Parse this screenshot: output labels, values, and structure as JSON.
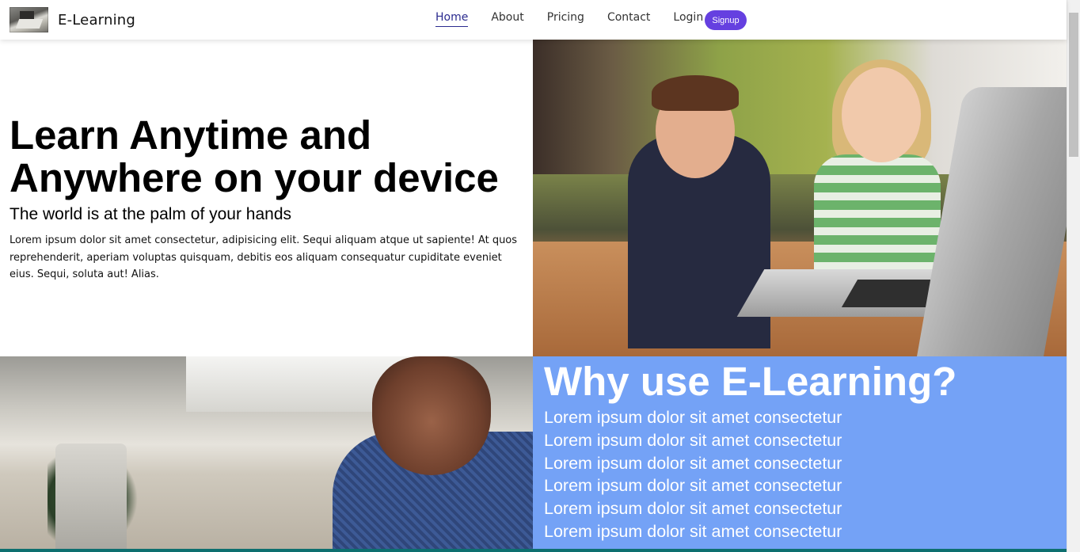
{
  "navbar": {
    "brand": "E-Learning",
    "links": [
      {
        "label": "Home",
        "active": true
      },
      {
        "label": "About",
        "active": false
      },
      {
        "label": "Pricing",
        "active": false
      },
      {
        "label": "Contact",
        "active": false
      },
      {
        "label": "Login",
        "active": false
      }
    ],
    "signup_label": "Signup"
  },
  "hero": {
    "title": "Learn Anytime and Anywhere on your device",
    "subtitle": "The world is at the palm of your hands",
    "text": "Lorem ipsum dolor sit amet consectetur, adipisicing elit. Sequi aliquam atque ut sapiente! At quos reprehenderit, aperiam voluptas quisquam, debitis eos aliquam consequatur cupiditate eveniet eius. Sequi, soluta aut! Alias."
  },
  "why": {
    "title": "Why use E-Learning?",
    "items": [
      "Lorem ipsum dolor sit amet consectetur",
      "Lorem ipsum dolor sit amet consectetur",
      "Lorem ipsum dolor sit amet consectetur",
      "Lorem ipsum dolor sit amet consectetur",
      "Lorem ipsum dolor sit amet consectetur",
      "Lorem ipsum dolor sit amet consectetur"
    ]
  },
  "colors": {
    "accent": "#6540e0",
    "why_panel_bg": "#74a2f6",
    "active_link": "#2b2b8f"
  }
}
